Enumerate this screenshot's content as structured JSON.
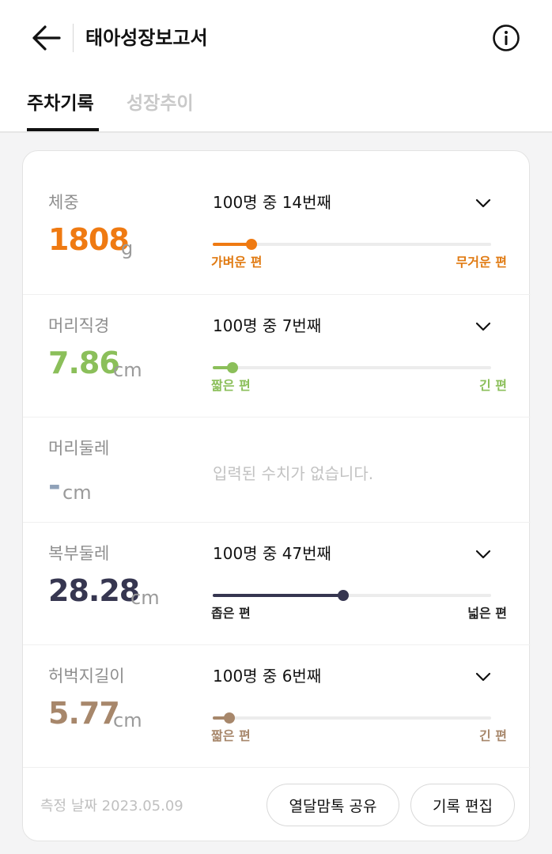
{
  "header": {
    "title": "태아성장보고서",
    "back_icon": "arrow-left-icon",
    "info_icon": "info-circle-icon"
  },
  "tabs": [
    {
      "label": "주차기록",
      "active": true
    },
    {
      "label": "성장추이",
      "active": false
    }
  ],
  "measurements": [
    {
      "label": "체중",
      "value": "1808",
      "unit": "g",
      "color": "#ef7a12",
      "rank": "100명 중 14번째",
      "percentile": 0.14,
      "left_label": "가벼운 편",
      "right_label": "무거운 편",
      "end_color": "#e07a12"
    },
    {
      "label": "머리직경",
      "value": "7.86",
      "unit": "cm",
      "color": "#8bbf5a",
      "rank": "100명 중 7번째",
      "percentile": 0.07,
      "left_label": "짧은 편",
      "right_label": "긴 편",
      "end_color": "#8bbf5a"
    },
    {
      "label": "머리둘레",
      "value": "-",
      "unit": "cm",
      "color": "#8fa1b8",
      "empty_message": "입력된 수치가 없습니다."
    },
    {
      "label": "복부둘레",
      "value": "28.28",
      "unit": "cm",
      "color": "#363650",
      "rank": "100명 중 47번째",
      "percentile": 0.47,
      "left_label": "좁은 편",
      "right_label": "넓은 편",
      "end_color": "#222222"
    },
    {
      "label": "허벅지길이",
      "value": "5.77",
      "unit": "cm",
      "color": "#a7876b",
      "rank": "100명 중 6번째",
      "percentile": 0.06,
      "left_label": "짧은 편",
      "right_label": "긴 편",
      "end_color": "#a7876b"
    }
  ],
  "footer": {
    "date_text": "측정 날짜 2023.05.09",
    "share_button": "열달맘톡 공유",
    "edit_button": "기록 편집"
  },
  "icons": {
    "chevron": "chevron-down-icon"
  }
}
